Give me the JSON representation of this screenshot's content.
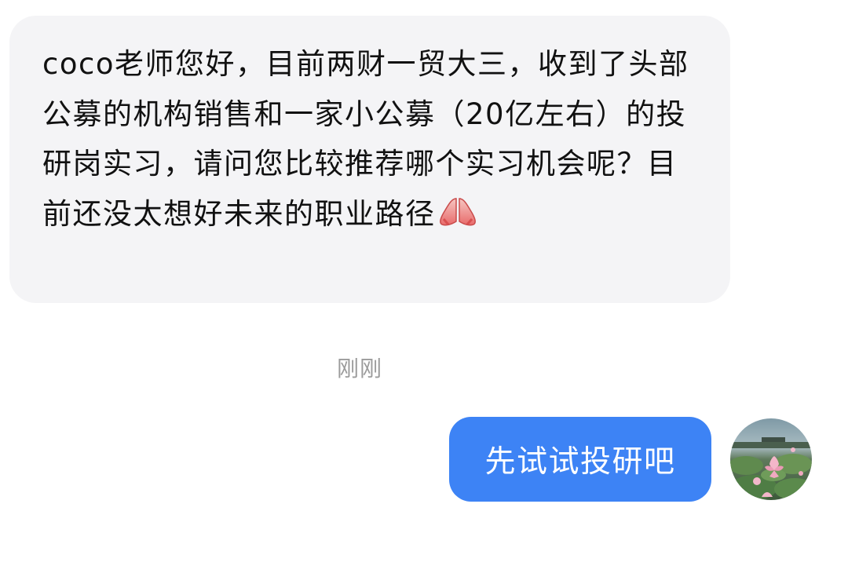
{
  "incoming_message": {
    "text": "coco老师您好，目前两财一贸大三，收到了头部公募的机构销售和一家小公募（20亿左右）的投研岗实习，请问您比较推荐哪个实习机会呢？目前还没太想好未来的职业路径",
    "emoji": "folded-hands-emoji"
  },
  "timestamp": "刚刚",
  "outgoing_message": {
    "text": "先试试投研吧"
  },
  "avatar": {
    "icon": "lotus-pond-avatar"
  },
  "colors": {
    "incoming_bubble": "#f4f4f6",
    "outgoing_bubble": "#3d83f5",
    "timestamp": "#9b9b9b"
  }
}
